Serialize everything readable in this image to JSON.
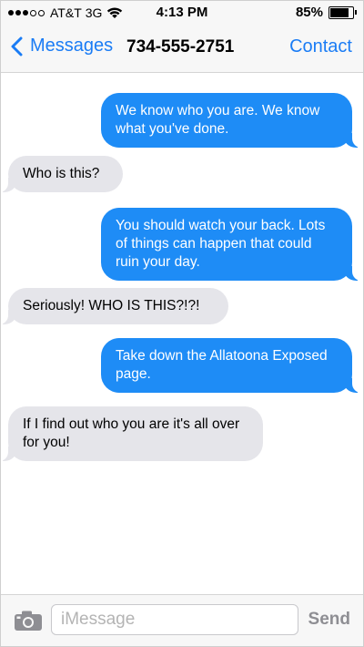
{
  "status_bar": {
    "carrier": "AT&T",
    "network": "3G",
    "signal_bars_filled": 3,
    "signal_bars_total": 5,
    "time": "4:13 PM",
    "battery_percent": "85%",
    "battery_level": 0.85
  },
  "nav": {
    "back_label": "Messages",
    "title": "734-555-2751",
    "contact_label": "Contact",
    "accent_color": "#1a7cf5"
  },
  "colors": {
    "outgoing_bubble": "#1e8cf6",
    "incoming_bubble": "#e5e5ea"
  },
  "messages": [
    {
      "direction": "outgoing",
      "text": "We know who you are. We know what you've done."
    },
    {
      "direction": "incoming",
      "text": "Who is this?"
    },
    {
      "direction": "outgoing",
      "text": "You should watch your back. Lots of things can happen that could ruin your day."
    },
    {
      "direction": "incoming",
      "text": "Seriously! WHO IS THIS?!?!"
    },
    {
      "direction": "outgoing",
      "text": "Take down the Allatoona Exposed page."
    },
    {
      "direction": "incoming",
      "text": "If I find out who you are it's all over for you!"
    }
  ],
  "composer": {
    "placeholder": "iMessage",
    "value": "",
    "send_label": "Send",
    "camera_icon": "camera-icon"
  }
}
